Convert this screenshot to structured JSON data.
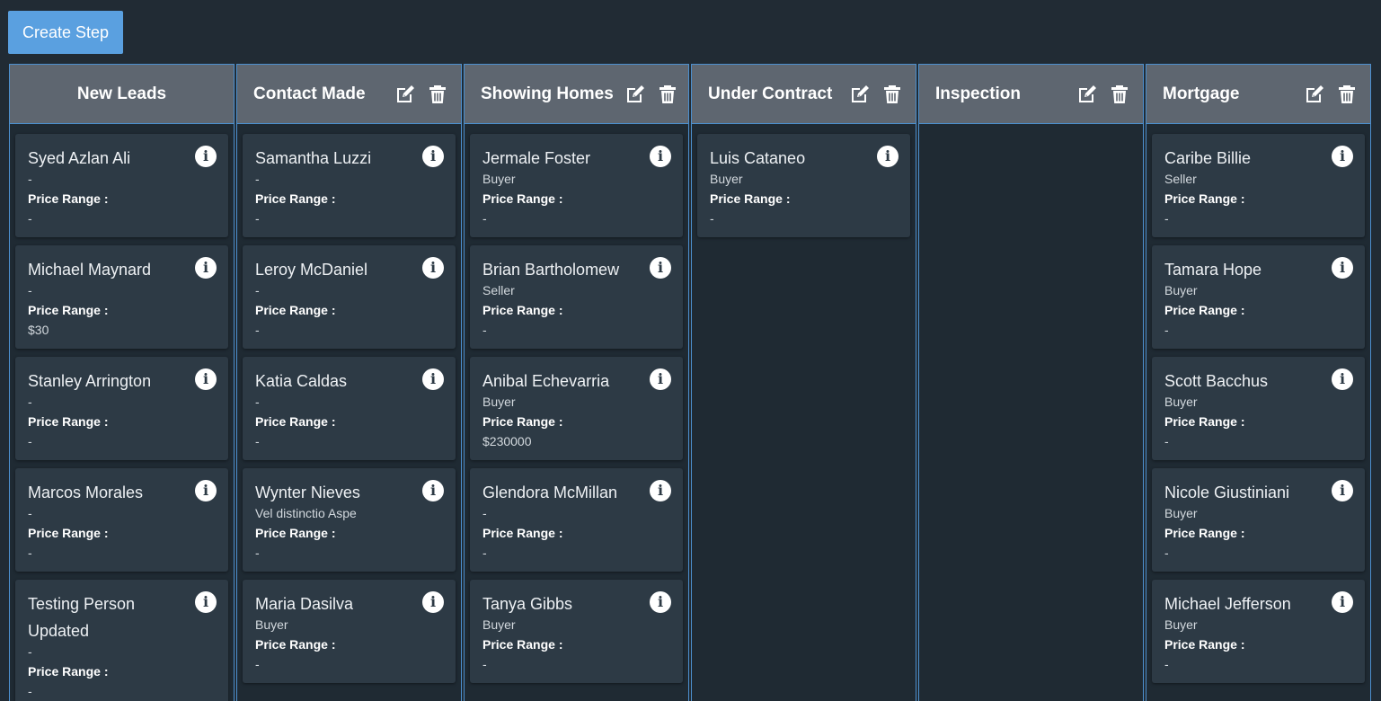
{
  "toolbar": {
    "create_step_label": "Create Step"
  },
  "price_range_label": "Price Range :",
  "columns": [
    {
      "title": "New Leads",
      "editable": false,
      "cards": [
        {
          "name": "Syed Azlan Ali",
          "type": "-",
          "price": "-"
        },
        {
          "name": "Michael Maynard",
          "type": "-",
          "price": "$30"
        },
        {
          "name": "Stanley Arrington",
          "type": "-",
          "price": "-"
        },
        {
          "name": "Marcos Morales",
          "type": "-",
          "price": "-"
        },
        {
          "name": "Testing Person Updated",
          "type": "-",
          "price": "-"
        }
      ]
    },
    {
      "title": "Contact Made",
      "editable": true,
      "cards": [
        {
          "name": "Samantha Luzzi",
          "type": "-",
          "price": "-"
        },
        {
          "name": "Leroy McDaniel",
          "type": "-",
          "price": "-"
        },
        {
          "name": "Katia Caldas",
          "type": "-",
          "price": "-"
        },
        {
          "name": "Wynter Nieves",
          "type": "Vel distinctio Aspe",
          "price": "-"
        },
        {
          "name": "Maria Dasilva",
          "type": "Buyer",
          "price": "-"
        }
      ]
    },
    {
      "title": "Showing Homes",
      "editable": true,
      "cards": [
        {
          "name": "Jermale Foster",
          "type": "Buyer",
          "price": "-"
        },
        {
          "name": "Brian Bartholomew",
          "type": "Seller",
          "price": "-"
        },
        {
          "name": "Anibal Echevarria",
          "type": "Buyer",
          "price": "$230000"
        },
        {
          "name": "Glendora McMillan",
          "type": "-",
          "price": "-"
        },
        {
          "name": "Tanya Gibbs",
          "type": "Buyer",
          "price": "-"
        }
      ]
    },
    {
      "title": "Under Contract",
      "editable": true,
      "cards": [
        {
          "name": "Luis Cataneo",
          "type": "Buyer",
          "price": "-"
        }
      ]
    },
    {
      "title": "Inspection",
      "editable": true,
      "cards": []
    },
    {
      "title": "Mortgage",
      "editable": true,
      "cards": [
        {
          "name": "Caribe Billie",
          "type": "Seller",
          "price": "-"
        },
        {
          "name": "Tamara Hope",
          "type": "Buyer",
          "price": "-"
        },
        {
          "name": "Scott Bacchus",
          "type": "Buyer",
          "price": "-"
        },
        {
          "name": "Nicole Giustiniani",
          "type": "Buyer",
          "price": "-"
        },
        {
          "name": "Michael Jefferson",
          "type": "Buyer",
          "price": "-"
        }
      ]
    }
  ]
}
